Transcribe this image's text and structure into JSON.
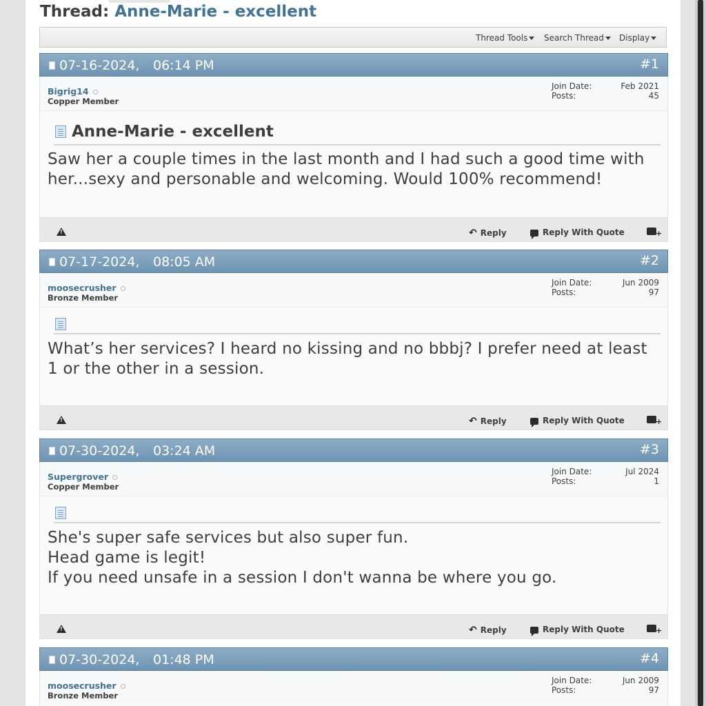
{
  "thread": {
    "prefix": "Thread:",
    "title": "Anne-Marie - excellent"
  },
  "toolbar": {
    "thread_tools": "Thread Tools",
    "search_thread": "Search Thread",
    "display": "Display"
  },
  "labels": {
    "join_date": "Join Date:",
    "posts": "Posts:",
    "reply": "Reply",
    "reply_with_quote": "Reply With Quote"
  },
  "posts": [
    {
      "date": "07-16-2024,",
      "time": "06:14 PM",
      "number": "#1",
      "username": "Bigrig14",
      "usertitle": "Copper Member",
      "join_date": "Feb 2021",
      "post_count": "45",
      "title": "Anne-Marie - excellent",
      "lines": [
        "Saw her a couple times in the last month and I had such a good time with",
        "her...sexy and personable and welcoming. Would 100% recommend!"
      ]
    },
    {
      "date": "07-17-2024,",
      "time": "08:05 AM",
      "number": "#2",
      "username": "moosecrusher",
      "usertitle": "Bronze Member",
      "join_date": "Jun 2009",
      "post_count": "97",
      "title": "",
      "lines": [
        "What’s her services? I heard no kissing and no bbbj? I prefer need at least",
        "1 or the other in a session."
      ]
    },
    {
      "date": "07-30-2024,",
      "time": "03:24 AM",
      "number": "#3",
      "username": "Supergrover",
      "usertitle": "Copper Member",
      "join_date": "Jul 2024",
      "post_count": "1",
      "title": "",
      "lines": [
        "She's super safe services but also super fun.",
        "Head game is legit!",
        "If you need unsafe in a session I don't wanna be where you go."
      ]
    },
    {
      "date": "07-30-2024,",
      "time": "01:48 PM",
      "number": "#4",
      "username": "moosecrusher",
      "usertitle": "Bronze Member",
      "join_date": "Jun 2009",
      "post_count": "97"
    }
  ]
}
